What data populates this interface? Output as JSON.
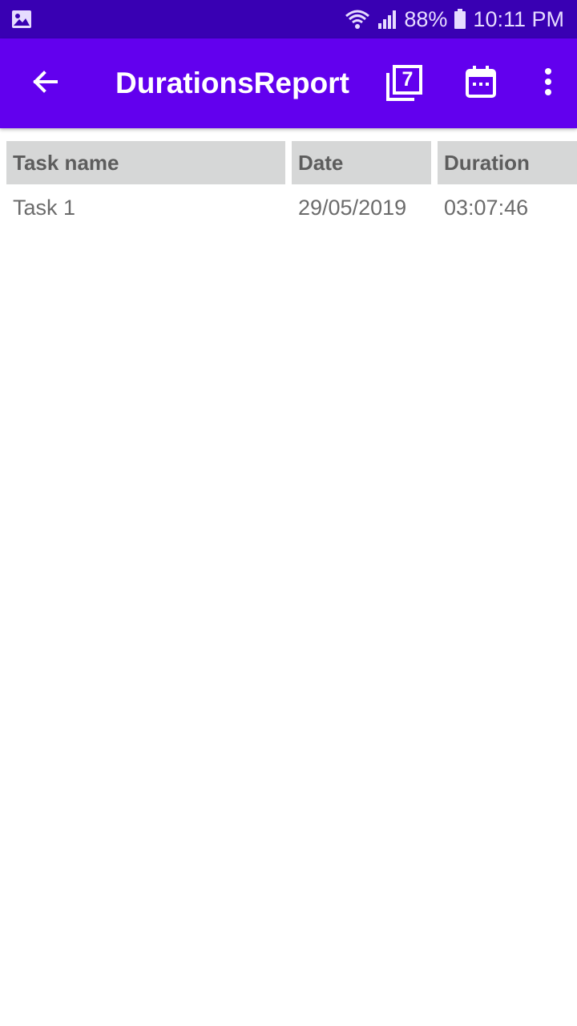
{
  "status_bar": {
    "battery": "88%",
    "time": "10:11 PM"
  },
  "app_bar": {
    "title": "DurationsReport",
    "calendar_number": "7",
    "icons": [
      "arrow-back-icon",
      "filter-7-icon",
      "calendar-icon",
      "more-vert-icon"
    ]
  },
  "table": {
    "headers": [
      "Task name",
      "Date",
      "Duration"
    ],
    "rows": [
      [
        "Task 1",
        "29/05/2019",
        "03:07:46"
      ]
    ]
  },
  "colors": {
    "status_bar": "#3900b3",
    "app_bar": "#6200ee",
    "header_bg": "#d6d7d7",
    "header_text": "#5d5d5d",
    "cell_text": "#6b6b6b"
  }
}
